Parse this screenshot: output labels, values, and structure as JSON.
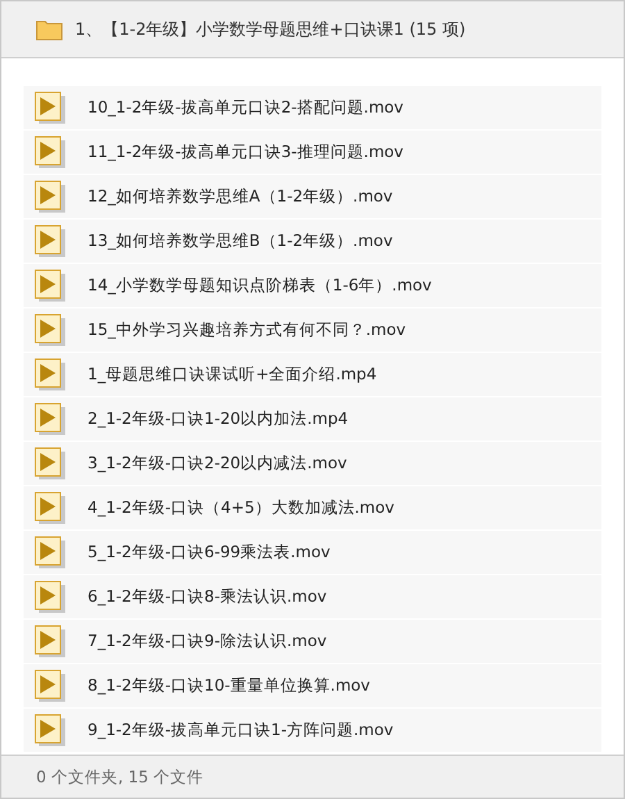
{
  "header": {
    "title": "1、【1-2年级】小学数学母题思维+口诀课1 (15 项)"
  },
  "files": [
    {
      "name": "10_1-2年级-拔高单元口诀2-搭配问题.mov"
    },
    {
      "name": "11_1-2年级-拔高单元口诀3-推理问题.mov"
    },
    {
      "name": "12_如何培养数学思维A（1-2年级）.mov"
    },
    {
      "name": "13_如何培养数学思维B（1-2年级）.mov"
    },
    {
      "name": "14_小学数学母题知识点阶梯表（1-6年）.mov"
    },
    {
      "name": "15_中外学习兴趣培养方式有何不同？.mov"
    },
    {
      "name": "1_母题思维口诀课试听+全面介绍.mp4"
    },
    {
      "name": "2_1-2年级-口诀1-20以内加法.mp4"
    },
    {
      "name": "3_1-2年级-口诀2-20以内减法.mov"
    },
    {
      "name": "4_1-2年级-口诀（4+5）大数加减法.mov"
    },
    {
      "name": "5_1-2年级-口诀6-99乘法表.mov"
    },
    {
      "name": "6_1-2年级-口诀8-乘法认识.mov"
    },
    {
      "name": "7_1-2年级-口诀9-除法认识.mov"
    },
    {
      "name": "8_1-2年级-口诀10-重量单位换算.mov"
    },
    {
      "name": "9_1-2年级-拔高单元口诀1-方阵问题.mov"
    }
  ],
  "status_bar": {
    "text": "0 个文件夹, 15 个文件"
  }
}
